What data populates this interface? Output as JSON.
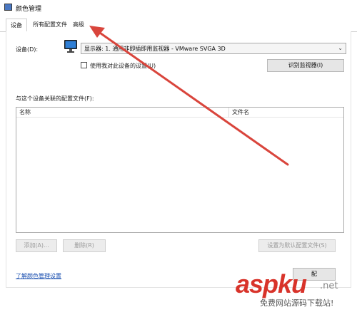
{
  "window": {
    "title": "颜色管理",
    "icon": "color-management-icon"
  },
  "tabs": [
    {
      "label": "设备",
      "active": true
    },
    {
      "label": "所有配置文件",
      "active": false
    },
    {
      "label": "高级",
      "active": false
    }
  ],
  "device": {
    "label": "设备(D):",
    "selected": "显示器: 1. 通用非即插即用监视器 - VMware SVGA 3D",
    "monitor_icon": "monitor-icon",
    "checkbox_label": "使用我对此设备的设置(U)",
    "checkbox_checked": false,
    "identify_button": "识别监视器(I)"
  },
  "profiles": {
    "section_label": "与这个设备关联的配置文件(F):",
    "columns": [
      "名称",
      "文件名"
    ],
    "rows": []
  },
  "buttons": {
    "add": "添加(A)...",
    "remove": "删除(R)",
    "set_default": "设置为默认配置文件(S)",
    "profiles": "配"
  },
  "link": "了解颜色管理设置",
  "watermark": {
    "text": "aspku",
    "net": ".net",
    "sub": "免费网站源码下载站!"
  },
  "colors": {
    "arrow": "#d9453c",
    "link": "#1a4fb0",
    "watermark": "#d8332a"
  }
}
